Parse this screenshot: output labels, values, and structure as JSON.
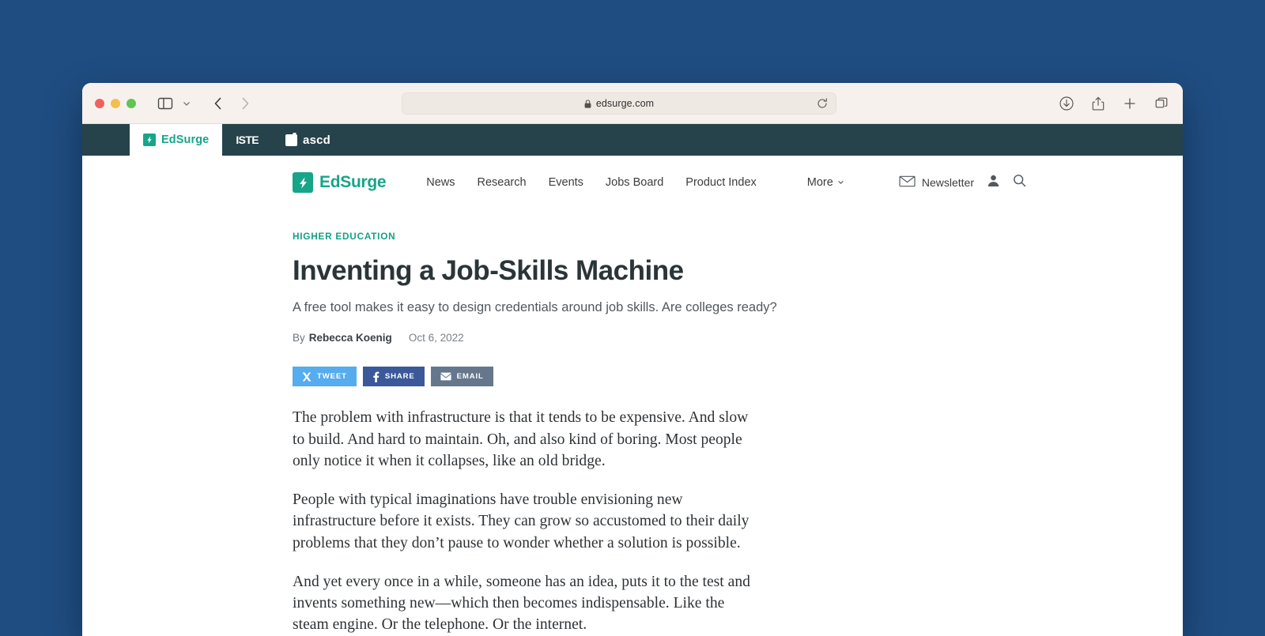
{
  "browser": {
    "url": "edsurge.com",
    "lock_icon": "lock-icon",
    "reload_icon": "reload-icon",
    "sidebar_icon": "sidebar-toggle-icon",
    "sidebar_caret_icon": "chevron-down-icon",
    "back_icon": "chevron-left-icon",
    "forward_icon": "chevron-right-icon",
    "right_icons": [
      "download-icon",
      "share-icon",
      "new-tab-icon",
      "tab-overview-icon"
    ],
    "tabs": [
      {
        "label": "EdSurge",
        "favicon": "edsurge-bolt-icon",
        "active": true
      },
      {
        "label": "ISTE",
        "favicon": "iste-wordmark-icon",
        "active": false
      },
      {
        "label": "ascd",
        "favicon": "ascd-mark-icon",
        "active": false
      }
    ]
  },
  "site": {
    "brand": "EdSurge",
    "brand_icon": "lightning-bolt-icon",
    "nav": [
      {
        "label": "News"
      },
      {
        "label": "Research"
      },
      {
        "label": "Events"
      },
      {
        "label": "Jobs Board"
      },
      {
        "label": "Product Index"
      }
    ],
    "more_label": "More",
    "more_icon": "chevron-down-icon",
    "newsletter_label": "Newsletter",
    "newsletter_icon": "envelope-icon",
    "account_icon": "person-icon",
    "search_icon": "search-icon"
  },
  "article": {
    "kicker": "HIGHER EDUCATION",
    "headline": "Inventing a Job-Skills Machine",
    "dek": "A free tool makes it easy to design credentials around job skills. Are colleges ready?",
    "by_prefix": "By",
    "author": "Rebecca Koenig",
    "date": "Oct 6, 2022",
    "share": [
      {
        "label": "TWEET",
        "icon": "x-twitter-icon",
        "color": "#55acee"
      },
      {
        "label": "SHARE",
        "icon": "facebook-icon",
        "color": "#3b5998"
      },
      {
        "label": "EMAIL",
        "icon": "envelope-icon",
        "color": "#64778c"
      }
    ],
    "paragraphs": [
      "The problem with infrastructure is that it tends to be expensive. And slow to build. And hard to maintain. Oh, and also kind of boring. Most people only notice it when it collapses, like an old bridge.",
      "People with typical imaginations have trouble envisioning new infrastructure before it exists. They can grow so accustomed to their daily problems that they don’t pause to wonder whether a solution is possible.",
      "And yet every once in a while, someone has an idea, puts it to the test and invents something new—which then becomes indispensable. Like the steam engine. Or the telephone. Or the internet."
    ]
  },
  "colors": {
    "desktop": "#1f4d82",
    "toolbar": "#f6f1ed",
    "tabstrip": "#26424b",
    "brand_teal": "#17a589",
    "kicker_teal": "#16a085"
  }
}
